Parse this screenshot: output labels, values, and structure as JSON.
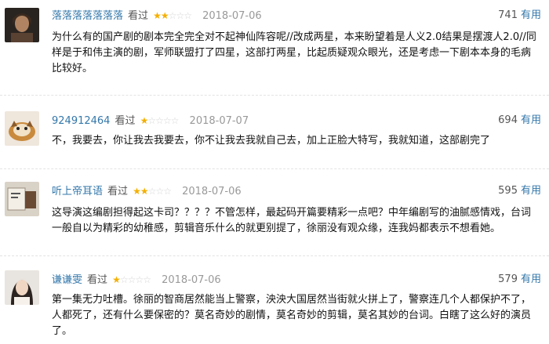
{
  "reviews": [
    {
      "username": "落落落落落落落",
      "status": "看过",
      "stars": "★★☆☆☆",
      "stars_on": "★★",
      "stars_off": "☆☆☆",
      "date": "2018-07-06",
      "votes": "741",
      "useful": "有用",
      "content": "为什么有的国产剧的剧本完全完全对不起神仙阵容呢//改成两星，本来盼望着是人义2.0结果是摆渡人2.0//同样是于和伟主演的剧，军师联盟打了四星，这部打两星，比起质疑观众眼光，还是考虑一下剧本本身的毛病比较好。"
    },
    {
      "username": "924912464",
      "status": "看过",
      "stars": "★☆☆☆☆",
      "stars_on": "★",
      "stars_off": "☆☆☆☆",
      "date": "2018-07-07",
      "votes": "694",
      "useful": "有用",
      "content": "不，我要去，你让我去我要去，你不让我去我就自己去，加上正脸大特写，我就知道，这部剧完了"
    },
    {
      "username": "听上帝耳语",
      "status": "看过",
      "stars": "★★☆☆☆",
      "stars_on": "★★",
      "stars_off": "☆☆☆",
      "date": "2018-07-06",
      "votes": "595",
      "useful": "有用",
      "content": "这导演这编剧担得起这卡司？？？？不管怎样，最起码开篇要精彩一点吧？中年编剧写的油腻感情戏，台词一般自以为精彩的幼稚感，剪辑音乐什么的就更别提了，徐丽没有观众缘，连我妈都表示不想看她。"
    },
    {
      "username": "谦谦雯",
      "status": "看过",
      "stars": "★☆☆☆☆",
      "stars_on": "★",
      "stars_off": "☆☆☆☆",
      "date": "2018-07-06",
      "votes": "579",
      "useful": "有用",
      "content": "第一集无力吐槽。徐丽的智商居然能当上警察，泱泱大国居然当街就火拼上了，警察连几个人都保护不了，人都死了，还有什么要保密的？莫名奇妙的剧情，莫名奇妙的剪辑，莫名其妙的台词。白瞎了这么好的演员了。"
    }
  ],
  "colors": {
    "link": "#3377aa",
    "star_on": "#f4b000",
    "star_off": "#d4d4d4",
    "date": "#999999",
    "text": "#111111"
  }
}
